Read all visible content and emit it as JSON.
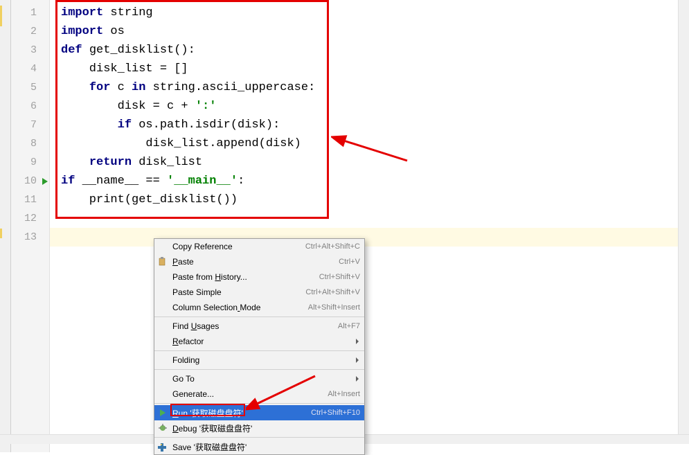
{
  "code": {
    "lines": [
      {
        "n": "1",
        "tokens": [
          {
            "t": "import",
            "c": "kw"
          },
          {
            "t": " string",
            "c": "plain"
          }
        ]
      },
      {
        "n": "2",
        "tokens": [
          {
            "t": "import",
            "c": "kw"
          },
          {
            "t": " os",
            "c": "plain"
          }
        ]
      },
      {
        "n": "3",
        "tokens": [
          {
            "t": "def ",
            "c": "kw"
          },
          {
            "t": "get_disklist():",
            "c": "plain"
          }
        ]
      },
      {
        "n": "4",
        "tokens": [
          {
            "t": "    disk_list = []",
            "c": "plain"
          }
        ]
      },
      {
        "n": "5",
        "tokens": [
          {
            "t": "    ",
            "c": "plain"
          },
          {
            "t": "for",
            "c": "kw"
          },
          {
            "t": " c ",
            "c": "plain"
          },
          {
            "t": "in",
            "c": "kw"
          },
          {
            "t": " string.ascii_uppercase:",
            "c": "plain"
          }
        ]
      },
      {
        "n": "6",
        "tokens": [
          {
            "t": "        disk = c + ",
            "c": "plain"
          },
          {
            "t": "':'",
            "c": "str"
          }
        ]
      },
      {
        "n": "7",
        "tokens": [
          {
            "t": "        ",
            "c": "plain"
          },
          {
            "t": "if",
            "c": "kw"
          },
          {
            "t": " os.path.isdir(disk):",
            "c": "plain"
          }
        ]
      },
      {
        "n": "8",
        "tokens": [
          {
            "t": "            disk_list.append(disk)",
            "c": "plain"
          }
        ]
      },
      {
        "n": "9",
        "tokens": [
          {
            "t": "    ",
            "c": "plain"
          },
          {
            "t": "return",
            "c": "kw"
          },
          {
            "t": " disk_list",
            "c": "plain"
          }
        ]
      },
      {
        "n": "10",
        "tokens": [
          {
            "t": "if",
            "c": "kw"
          },
          {
            "t": " __name__ == ",
            "c": "plain"
          },
          {
            "t": "'__main__'",
            "c": "str"
          },
          {
            "t": ":",
            "c": "plain"
          }
        ],
        "run": true
      },
      {
        "n": "11",
        "tokens": [
          {
            "t": "    print(get_disklist())",
            "c": "plain"
          }
        ]
      },
      {
        "n": "12",
        "tokens": []
      },
      {
        "n": "13",
        "tokens": [],
        "current": true
      }
    ]
  },
  "menu": {
    "items": [
      {
        "label": "Copy Reference",
        "shortcut": "Ctrl+Alt+Shift+C"
      },
      {
        "label": "Paste",
        "u": 0,
        "shortcut": "Ctrl+V",
        "icon": "paste"
      },
      {
        "label": "Paste from History...",
        "u": 11,
        "shortcut": "Ctrl+Shift+V"
      },
      {
        "label": "Paste Simple",
        "shortcut": "Ctrl+Alt+Shift+V"
      },
      {
        "label": "Column Selection Mode",
        "u": 16,
        "shortcut": "Alt+Shift+Insert"
      },
      {
        "sep": true
      },
      {
        "label": "Find Usages",
        "u": 5,
        "shortcut": "Alt+F7"
      },
      {
        "label": "Refactor",
        "u": 0,
        "submenu": true
      },
      {
        "sep": true
      },
      {
        "label": "Folding",
        "submenu": true
      },
      {
        "sep": true
      },
      {
        "label": "Go To",
        "submenu": true
      },
      {
        "label": "Generate...",
        "shortcut": "Alt+Insert"
      },
      {
        "sep": true
      },
      {
        "label": "Run '获取磁盘盘符'",
        "u": 0,
        "shortcut": "Ctrl+Shift+F10",
        "icon": "run",
        "highlighted": true
      },
      {
        "label": "Debug '获取磁盘盘符'",
        "u": 0,
        "icon": "debug"
      },
      {
        "sep": true
      },
      {
        "label": "Save '获取磁盘盘符'",
        "icon": "python"
      }
    ]
  }
}
